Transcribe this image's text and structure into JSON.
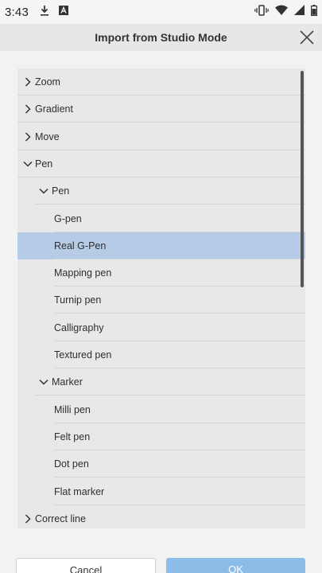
{
  "status_bar": {
    "time": "3:43",
    "left_icons": [
      "download-icon",
      "app-notification-icon"
    ],
    "right_icons": [
      "vibrate-icon",
      "wifi-icon",
      "signal-icon",
      "battery-icon"
    ]
  },
  "dialog": {
    "title": "Import from Studio Mode",
    "close_icon": "close-icon"
  },
  "tree": {
    "items": [
      {
        "label": "Zoom",
        "level": 0,
        "expanded": false
      },
      {
        "label": "Gradient",
        "level": 0,
        "expanded": false
      },
      {
        "label": "Move",
        "level": 0,
        "expanded": false
      },
      {
        "label": "Pen",
        "level": 0,
        "expanded": true
      },
      {
        "label": "Pen",
        "level": 1,
        "expanded": true
      },
      {
        "label": "G-pen",
        "level": 2
      },
      {
        "label": "Real G-Pen",
        "level": 2,
        "selected": true
      },
      {
        "label": "Mapping pen",
        "level": 2
      },
      {
        "label": "Turnip pen",
        "level": 2
      },
      {
        "label": "Calligraphy",
        "level": 2
      },
      {
        "label": "Textured pen",
        "level": 2
      },
      {
        "label": "Marker",
        "level": 1,
        "expanded": true
      },
      {
        "label": "Milli pen",
        "level": 2
      },
      {
        "label": "Felt pen",
        "level": 2
      },
      {
        "label": "Dot pen",
        "level": 2
      },
      {
        "label": "Flat marker",
        "level": 2
      },
      {
        "label": "Correct line",
        "level": 0,
        "expanded": false
      }
    ]
  },
  "buttons": {
    "cancel": "Cancel",
    "ok": "OK"
  },
  "colors": {
    "selected_row": "#b6cce6",
    "ok_button": "#8cbce8",
    "panel": "#e8e8e8"
  }
}
